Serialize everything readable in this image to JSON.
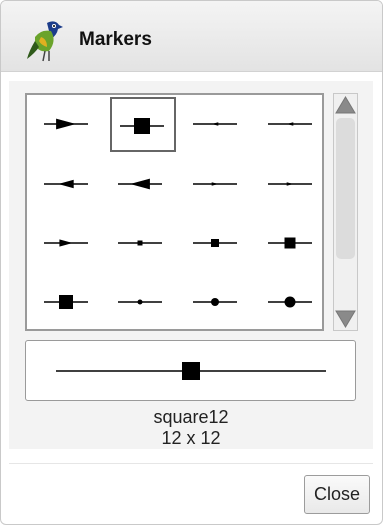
{
  "dialog": {
    "title": "Markers",
    "logo_icon": "green-bird-logo-icon"
  },
  "markers": [
    {
      "id": "arrow-right-large"
    },
    {
      "id": "square12"
    },
    {
      "id": "arrow-left-small"
    },
    {
      "id": "arrow-left-small-2"
    },
    {
      "id": "arrow-left-medium"
    },
    {
      "id": "arrow-left-large"
    },
    {
      "id": "arrow-right-small"
    },
    {
      "id": "arrow-right-small-2"
    },
    {
      "id": "arrow-right-medium"
    },
    {
      "id": "square-tiny"
    },
    {
      "id": "square-small"
    },
    {
      "id": "square-medium"
    },
    {
      "id": "square-large"
    },
    {
      "id": "dot-tiny"
    },
    {
      "id": "dot-small"
    },
    {
      "id": "dot-medium"
    }
  ],
  "selected": {
    "name": "square12",
    "size_label": "12 x 12"
  },
  "buttons": {
    "close_label": "Close"
  },
  "colors": {
    "marker": "#000000",
    "border": "#9a9a9a",
    "panel": "#f3f3f3"
  }
}
